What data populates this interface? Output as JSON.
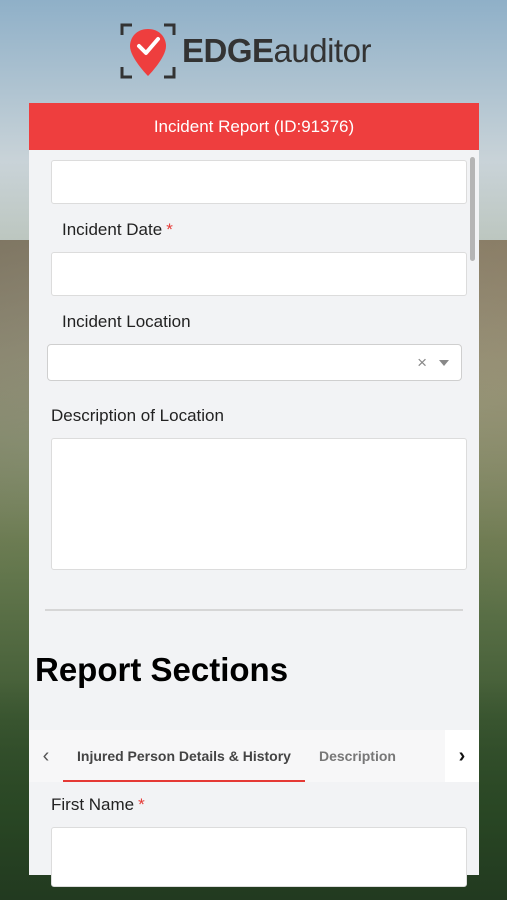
{
  "brand": {
    "name_bold": "EDGE",
    "name_regular": "auditor",
    "accent_color": "#ee3e3e"
  },
  "header": {
    "title": "Incident Report (ID:91376)"
  },
  "form": {
    "top_field_value": "",
    "incident_date": {
      "label": "Incident Date",
      "required_mark": "*",
      "value": ""
    },
    "incident_location": {
      "label": "Incident Location",
      "value": "",
      "clear_icon": "×"
    },
    "description_of_location": {
      "label": "Description of Location",
      "value": ""
    }
  },
  "sections": {
    "title": "Report Sections",
    "tabs": [
      {
        "label": "Injured Person Details & History",
        "active": true
      },
      {
        "label": "Description",
        "active": false
      }
    ],
    "prev_icon": "‹",
    "next_icon": "›"
  },
  "injured_person": {
    "first_name": {
      "label": "First Name",
      "required_mark": "*",
      "value": ""
    }
  }
}
